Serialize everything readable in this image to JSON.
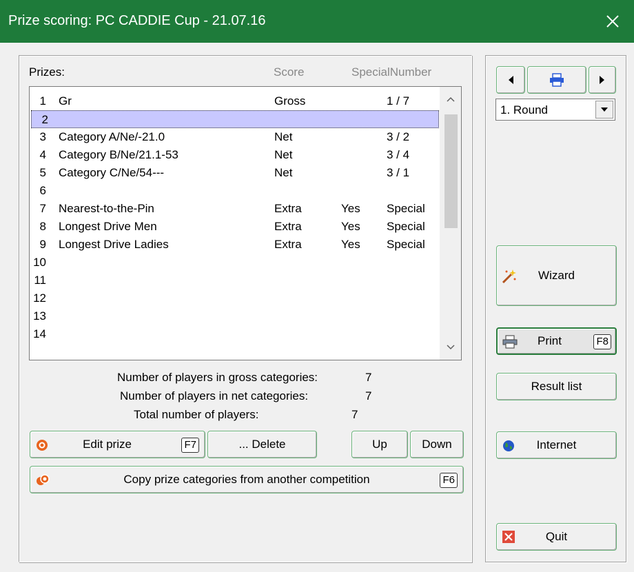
{
  "window": {
    "title": "Prize scoring: PC CADDIE Cup - 21.07.16",
    "close_icon": "close-icon"
  },
  "headers": {
    "prizes": "Prizes:",
    "score": "Score",
    "special_number": "SpecialNumber"
  },
  "prizes": [
    {
      "num": "1",
      "name": "Gr",
      "score": "Gross",
      "yes": "",
      "special": "1 / 7"
    },
    {
      "num": "2",
      "name": "",
      "score": "",
      "yes": "",
      "special": ""
    },
    {
      "num": "3",
      "name": "Category A/Ne/-21.0",
      "score": "Net",
      "yes": "",
      "special": "3 / 2"
    },
    {
      "num": "4",
      "name": "Category B/Ne/21.1-53",
      "score": "Net",
      "yes": "",
      "special": "3 / 4"
    },
    {
      "num": "5",
      "name": "Category C/Ne/54---",
      "score": "Net",
      "yes": "",
      "special": "3 / 1"
    },
    {
      "num": "6",
      "name": "",
      "score": "",
      "yes": "",
      "special": ""
    },
    {
      "num": "7",
      "name": "Nearest-to-the-Pin",
      "score": "Extra",
      "yes": "Yes",
      "special": "Special"
    },
    {
      "num": "8",
      "name": "Longest Drive Men",
      "score": "Extra",
      "yes": "Yes",
      "special": "Special"
    },
    {
      "num": "9",
      "name": "Longest Drive Ladies",
      "score": "Extra",
      "yes": "Yes",
      "special": "Special"
    },
    {
      "num": "10",
      "name": "",
      "score": "",
      "yes": "",
      "special": ""
    },
    {
      "num": "11",
      "name": "",
      "score": "",
      "yes": "",
      "special": ""
    },
    {
      "num": "12",
      "name": "",
      "score": "",
      "yes": "",
      "special": ""
    },
    {
      "num": "13",
      "name": "",
      "score": "",
      "yes": "",
      "special": ""
    },
    {
      "num": "14",
      "name": "",
      "score": "",
      "yes": "",
      "special": ""
    }
  ],
  "selected_row": "2",
  "stats": {
    "gross_label": "Number of players in gross categories:",
    "gross_value": "7",
    "net_label": "Number of players in net categories:",
    "net_value": "7",
    "total_label": "Total number of players:",
    "total_value": "7"
  },
  "buttons": {
    "edit_prize": "Edit prize",
    "edit_prize_key": "F7",
    "delete": "... Delete",
    "up": "Up",
    "down": "Down",
    "copy": "Copy prize categories from another competition",
    "copy_key": "F6",
    "wizard": "Wizard",
    "print": "Print",
    "print_key": "F8",
    "result_list": "Result list",
    "internet": "Internet",
    "quit": "Quit"
  },
  "round_select": {
    "value": "1. Round"
  },
  "colors": {
    "titlebar": "#1e7b3a",
    "button_border": "#6ab27a",
    "selection": "#c8c8ff"
  }
}
